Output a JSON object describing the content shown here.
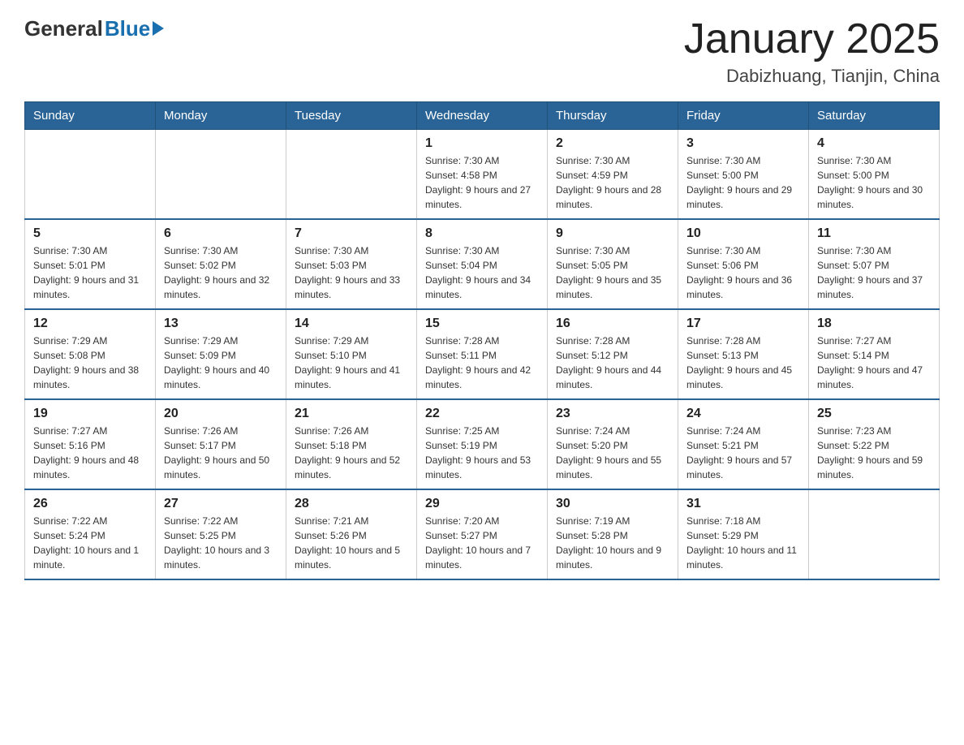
{
  "header": {
    "logo_general": "General",
    "logo_blue": "Blue",
    "month_title": "January 2025",
    "location": "Dabizhuang, Tianjin, China"
  },
  "days_of_week": [
    "Sunday",
    "Monday",
    "Tuesday",
    "Wednesday",
    "Thursday",
    "Friday",
    "Saturday"
  ],
  "weeks": [
    [
      {
        "day": "",
        "sunrise": "",
        "sunset": "",
        "daylight": ""
      },
      {
        "day": "",
        "sunrise": "",
        "sunset": "",
        "daylight": ""
      },
      {
        "day": "",
        "sunrise": "",
        "sunset": "",
        "daylight": ""
      },
      {
        "day": "1",
        "sunrise": "Sunrise: 7:30 AM",
        "sunset": "Sunset: 4:58 PM",
        "daylight": "Daylight: 9 hours and 27 minutes."
      },
      {
        "day": "2",
        "sunrise": "Sunrise: 7:30 AM",
        "sunset": "Sunset: 4:59 PM",
        "daylight": "Daylight: 9 hours and 28 minutes."
      },
      {
        "day": "3",
        "sunrise": "Sunrise: 7:30 AM",
        "sunset": "Sunset: 5:00 PM",
        "daylight": "Daylight: 9 hours and 29 minutes."
      },
      {
        "day": "4",
        "sunrise": "Sunrise: 7:30 AM",
        "sunset": "Sunset: 5:00 PM",
        "daylight": "Daylight: 9 hours and 30 minutes."
      }
    ],
    [
      {
        "day": "5",
        "sunrise": "Sunrise: 7:30 AM",
        "sunset": "Sunset: 5:01 PM",
        "daylight": "Daylight: 9 hours and 31 minutes."
      },
      {
        "day": "6",
        "sunrise": "Sunrise: 7:30 AM",
        "sunset": "Sunset: 5:02 PM",
        "daylight": "Daylight: 9 hours and 32 minutes."
      },
      {
        "day": "7",
        "sunrise": "Sunrise: 7:30 AM",
        "sunset": "Sunset: 5:03 PM",
        "daylight": "Daylight: 9 hours and 33 minutes."
      },
      {
        "day": "8",
        "sunrise": "Sunrise: 7:30 AM",
        "sunset": "Sunset: 5:04 PM",
        "daylight": "Daylight: 9 hours and 34 minutes."
      },
      {
        "day": "9",
        "sunrise": "Sunrise: 7:30 AM",
        "sunset": "Sunset: 5:05 PM",
        "daylight": "Daylight: 9 hours and 35 minutes."
      },
      {
        "day": "10",
        "sunrise": "Sunrise: 7:30 AM",
        "sunset": "Sunset: 5:06 PM",
        "daylight": "Daylight: 9 hours and 36 minutes."
      },
      {
        "day": "11",
        "sunrise": "Sunrise: 7:30 AM",
        "sunset": "Sunset: 5:07 PM",
        "daylight": "Daylight: 9 hours and 37 minutes."
      }
    ],
    [
      {
        "day": "12",
        "sunrise": "Sunrise: 7:29 AM",
        "sunset": "Sunset: 5:08 PM",
        "daylight": "Daylight: 9 hours and 38 minutes."
      },
      {
        "day": "13",
        "sunrise": "Sunrise: 7:29 AM",
        "sunset": "Sunset: 5:09 PM",
        "daylight": "Daylight: 9 hours and 40 minutes."
      },
      {
        "day": "14",
        "sunrise": "Sunrise: 7:29 AM",
        "sunset": "Sunset: 5:10 PM",
        "daylight": "Daylight: 9 hours and 41 minutes."
      },
      {
        "day": "15",
        "sunrise": "Sunrise: 7:28 AM",
        "sunset": "Sunset: 5:11 PM",
        "daylight": "Daylight: 9 hours and 42 minutes."
      },
      {
        "day": "16",
        "sunrise": "Sunrise: 7:28 AM",
        "sunset": "Sunset: 5:12 PM",
        "daylight": "Daylight: 9 hours and 44 minutes."
      },
      {
        "day": "17",
        "sunrise": "Sunrise: 7:28 AM",
        "sunset": "Sunset: 5:13 PM",
        "daylight": "Daylight: 9 hours and 45 minutes."
      },
      {
        "day": "18",
        "sunrise": "Sunrise: 7:27 AM",
        "sunset": "Sunset: 5:14 PM",
        "daylight": "Daylight: 9 hours and 47 minutes."
      }
    ],
    [
      {
        "day": "19",
        "sunrise": "Sunrise: 7:27 AM",
        "sunset": "Sunset: 5:16 PM",
        "daylight": "Daylight: 9 hours and 48 minutes."
      },
      {
        "day": "20",
        "sunrise": "Sunrise: 7:26 AM",
        "sunset": "Sunset: 5:17 PM",
        "daylight": "Daylight: 9 hours and 50 minutes."
      },
      {
        "day": "21",
        "sunrise": "Sunrise: 7:26 AM",
        "sunset": "Sunset: 5:18 PM",
        "daylight": "Daylight: 9 hours and 52 minutes."
      },
      {
        "day": "22",
        "sunrise": "Sunrise: 7:25 AM",
        "sunset": "Sunset: 5:19 PM",
        "daylight": "Daylight: 9 hours and 53 minutes."
      },
      {
        "day": "23",
        "sunrise": "Sunrise: 7:24 AM",
        "sunset": "Sunset: 5:20 PM",
        "daylight": "Daylight: 9 hours and 55 minutes."
      },
      {
        "day": "24",
        "sunrise": "Sunrise: 7:24 AM",
        "sunset": "Sunset: 5:21 PM",
        "daylight": "Daylight: 9 hours and 57 minutes."
      },
      {
        "day": "25",
        "sunrise": "Sunrise: 7:23 AM",
        "sunset": "Sunset: 5:22 PM",
        "daylight": "Daylight: 9 hours and 59 minutes."
      }
    ],
    [
      {
        "day": "26",
        "sunrise": "Sunrise: 7:22 AM",
        "sunset": "Sunset: 5:24 PM",
        "daylight": "Daylight: 10 hours and 1 minute."
      },
      {
        "day": "27",
        "sunrise": "Sunrise: 7:22 AM",
        "sunset": "Sunset: 5:25 PM",
        "daylight": "Daylight: 10 hours and 3 minutes."
      },
      {
        "day": "28",
        "sunrise": "Sunrise: 7:21 AM",
        "sunset": "Sunset: 5:26 PM",
        "daylight": "Daylight: 10 hours and 5 minutes."
      },
      {
        "day": "29",
        "sunrise": "Sunrise: 7:20 AM",
        "sunset": "Sunset: 5:27 PM",
        "daylight": "Daylight: 10 hours and 7 minutes."
      },
      {
        "day": "30",
        "sunrise": "Sunrise: 7:19 AM",
        "sunset": "Sunset: 5:28 PM",
        "daylight": "Daylight: 10 hours and 9 minutes."
      },
      {
        "day": "31",
        "sunrise": "Sunrise: 7:18 AM",
        "sunset": "Sunset: 5:29 PM",
        "daylight": "Daylight: 10 hours and 11 minutes."
      },
      {
        "day": "",
        "sunrise": "",
        "sunset": "",
        "daylight": ""
      }
    ]
  ]
}
